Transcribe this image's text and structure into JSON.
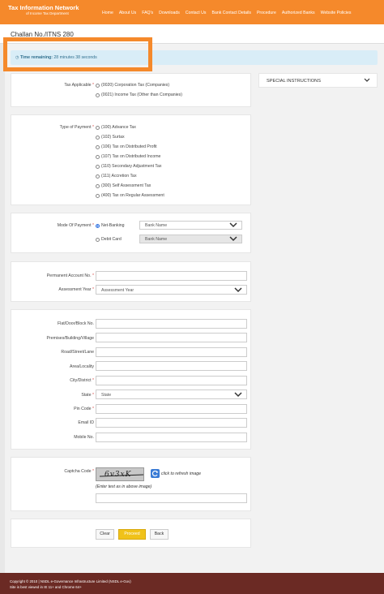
{
  "brand": {
    "title": "Tax Information Network",
    "subtitle": "of Income Tax Department"
  },
  "nav": [
    "Home",
    "About Us",
    "FAQ's",
    "Downloads",
    "Contact Us",
    "Bank Contact Details",
    "Procedure",
    "Authorized Banks",
    "Website Policies"
  ],
  "page_title": "Challan No./ITNS 280",
  "timer": {
    "label": "Time remaining:",
    "value": "28 minutes 38 seconds"
  },
  "special_instructions": "SPECIAL INSTRUCTIONS",
  "tax_applicable": {
    "label": "Tax Applicable",
    "options": [
      "(0020) Corporation Tax (Companies)",
      "(0021) Income Tax (Other than Companies)"
    ]
  },
  "type_of_payment": {
    "label": "Type of Payment",
    "options": [
      "(100) Advance Tax",
      "(102) Surtax",
      "(106) Tax on Distributed Profit",
      "(107) Tax on Distributed Income",
      "(110) Secondary Adjustment Tax",
      "(111) Accretion Tax",
      "(300) Self Assessment Tax",
      "(400) Tax on Regular Assessment"
    ]
  },
  "mode_of_payment": {
    "label": "Mode Of Payment",
    "net_banking": "Net-Banking",
    "debit_card": "Debit Card",
    "bank_placeholder": "Bank Name"
  },
  "pan": {
    "label": "Permanent Account No."
  },
  "assessment_year": {
    "label": "Assessment Year",
    "placeholder": "Assessment Year"
  },
  "address_fields": {
    "flat": "Flat/Door/Block No.",
    "premises": "Premises/Building/Village",
    "road": "Road/Street/Lane",
    "area": "Area/Locality",
    "city": "City/District",
    "state": "State",
    "state_placeholder": "State",
    "pin": "Pin Code",
    "email": "Email ID",
    "mobile": "Mobile No."
  },
  "captcha": {
    "label": "Captcha Code",
    "image_text": "6v3xK",
    "refresh": "click to refresh image",
    "hint": "(Enter text as in above image)"
  },
  "buttons": {
    "clear": "Clear",
    "proceed": "Proceed",
    "back": "Back"
  },
  "footer": {
    "copyright": "Copyright © 2010 | NSDL e-Governance Infrastructure Limited (NSDL e-Gov)",
    "note": "Site is best viewed in IE 11+ and Chrome 64+"
  },
  "colors": {
    "header": "#f5892b",
    "footer": "#6b2a24",
    "timer_bg": "#d9edf7",
    "proceed": "#f0c21a"
  }
}
